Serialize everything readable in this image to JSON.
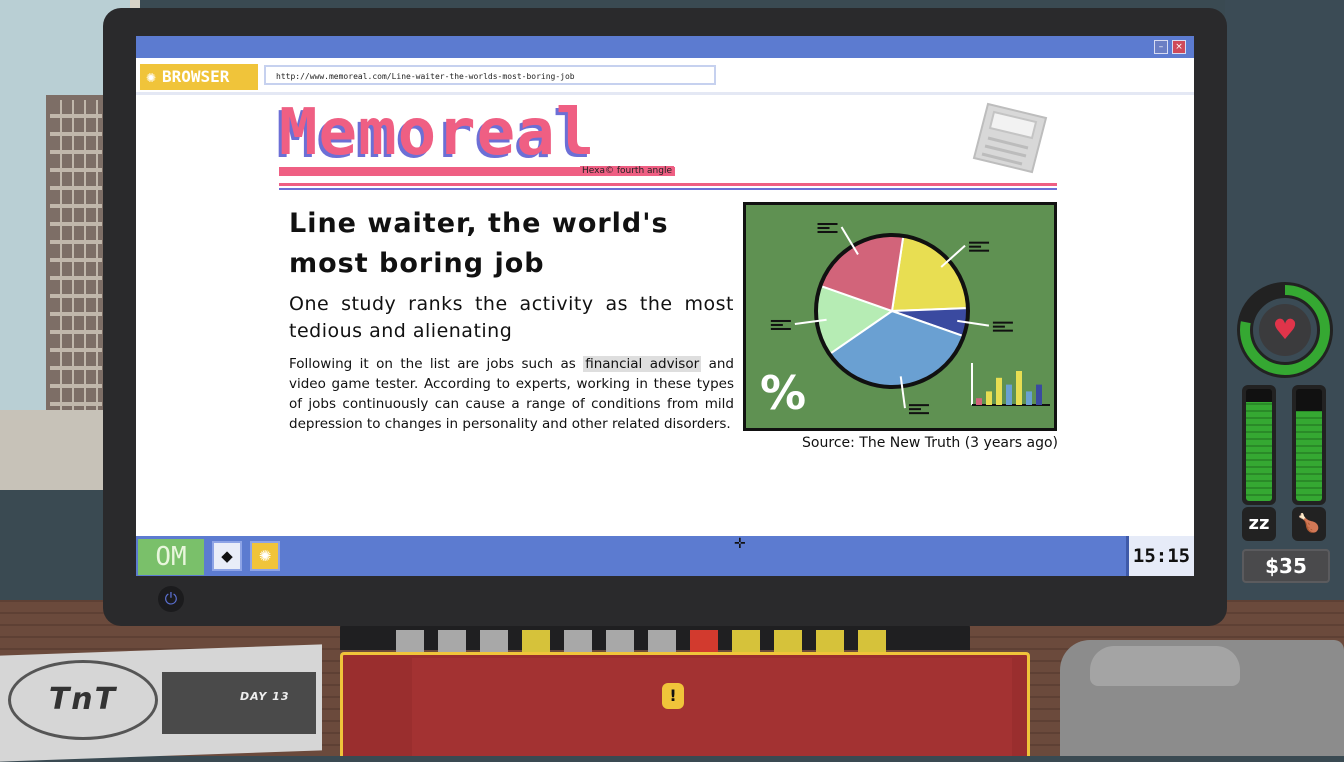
{
  "browser": {
    "app_label": "BROWSER",
    "url": "http://www.memoreal.com/Line-waiter-the-worlds-most-boring-job",
    "minimize_label": "–",
    "close_label": "×"
  },
  "site": {
    "name": "Memoreal",
    "tagline": "Hexa© fourth angle"
  },
  "article": {
    "headline": "Line waiter, the world's most boring job",
    "subheadline": "One study ranks the activity as the most tedious and alienating",
    "body_before": "Following it on the list are jobs such as ",
    "body_highlight": "financial advisor",
    "body_after": " and video game tester. According to experts, working in these types of jobs continuously can cause a range of conditions from mild depression to changes in personality and other related disorders.",
    "image_caption": "Source: The New Truth (3 years ago)"
  },
  "chart_data": [
    {
      "type": "pie",
      "values": [
        0.22,
        0.06,
        0.35,
        0.15,
        0.22
      ],
      "colors": [
        "#e8de52",
        "#3a4aa0",
        "#6aa0d2",
        "#b6ecb4",
        "#d2647a"
      ],
      "title": "",
      "xlabel": "",
      "ylabel": ""
    },
    {
      "type": "bar",
      "values": [
        1,
        2,
        4,
        3,
        5,
        2,
        3
      ],
      "colors": [
        "#d2647a",
        "#e8de52",
        "#e8de52",
        "#6aa0d2",
        "#e8de52",
        "#6aa0d2",
        "#3a4aa0"
      ],
      "title": "",
      "xlabel": "",
      "ylabel": ""
    }
  ],
  "chart_decor": {
    "percent_symbol": "%"
  },
  "taskbar": {
    "start_label": "OM",
    "app_icon": "◆",
    "browser_icon": "✺",
    "clock": "15:15"
  },
  "hud": {
    "health_fraction": 0.78,
    "sleep_fraction": 0.88,
    "hunger_fraction": 0.8,
    "sleep_icon": "zz",
    "hunger_icon": "🍗",
    "money": "$35",
    "heart_icon": "♥"
  },
  "desk": {
    "newspaper_logo": "TnT",
    "day_label": "DAY 13",
    "notebook_alert": "!",
    "power_icon": "⏻",
    "keys": [
      "#a8a8a8",
      "#a8a8a8",
      "#a8a8a8",
      "#d6c23a",
      "#a8a8a8",
      "#a8a8a8",
      "#a8a8a8",
      "#d23a2e",
      "#d6c23a",
      "#d6c23a",
      "#d6c23a",
      "#d6c23a"
    ]
  },
  "cursor": "✛"
}
